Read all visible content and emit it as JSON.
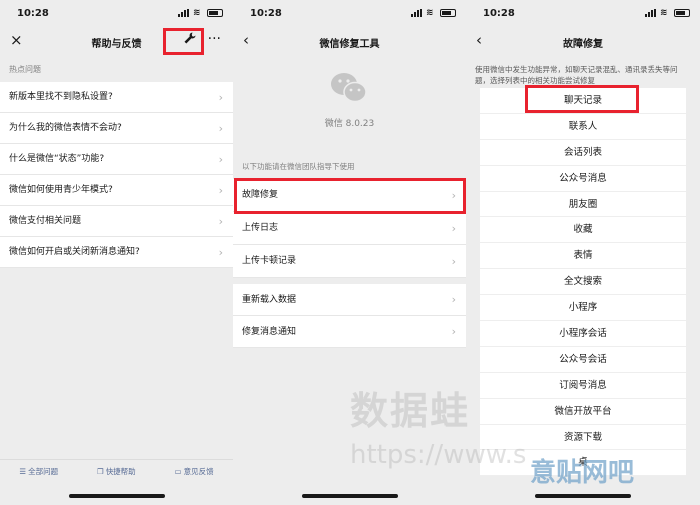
{
  "status": {
    "time": "10:28"
  },
  "panel1": {
    "title": "帮助与反馈",
    "close_icon": "×",
    "more_icon": "···",
    "section": "热点问题",
    "items": [
      "新版本里找不到隐私设置?",
      "为什么我的微信表情不会动?",
      "什么是微信“状态”功能?",
      "微信如何使用青少年模式?",
      "微信支付相关问题",
      "微信如何开启或关闭新消息通知?"
    ],
    "bottom": [
      "全部问题",
      "快捷帮助",
      "意见反馈"
    ]
  },
  "panel2": {
    "title": "微信修复工具",
    "version": "微信 8.0.23",
    "hint": "以下功能请在微信团队指导下使用",
    "group1": [
      "故障修复",
      "上传日志",
      "上传卡顿记录"
    ],
    "group2": [
      "重新载入数据",
      "修复消息通知"
    ]
  },
  "panel3": {
    "title": "故障修复",
    "desc": "使用微信中发生功能异常，如聊天记录混乱、通讯录丢失等问题，选择列表中的相关功能尝试修复",
    "items": [
      "聊天记录",
      "联系人",
      "会话列表",
      "公众号消息",
      "朋友圈",
      "收藏",
      "表情",
      "全文搜索",
      "小程序",
      "小程序会话",
      "公众号会话",
      "订阅号消息",
      "微信开放平台",
      "资源下载",
      "桌"
    ]
  },
  "watermarks": {
    "brand": "数据蛙",
    "url": "https://www.s",
    "site": "意贴网吧"
  },
  "colors": {
    "highlight": "#e8222e",
    "link": "#576b95",
    "background": "#ededed"
  }
}
